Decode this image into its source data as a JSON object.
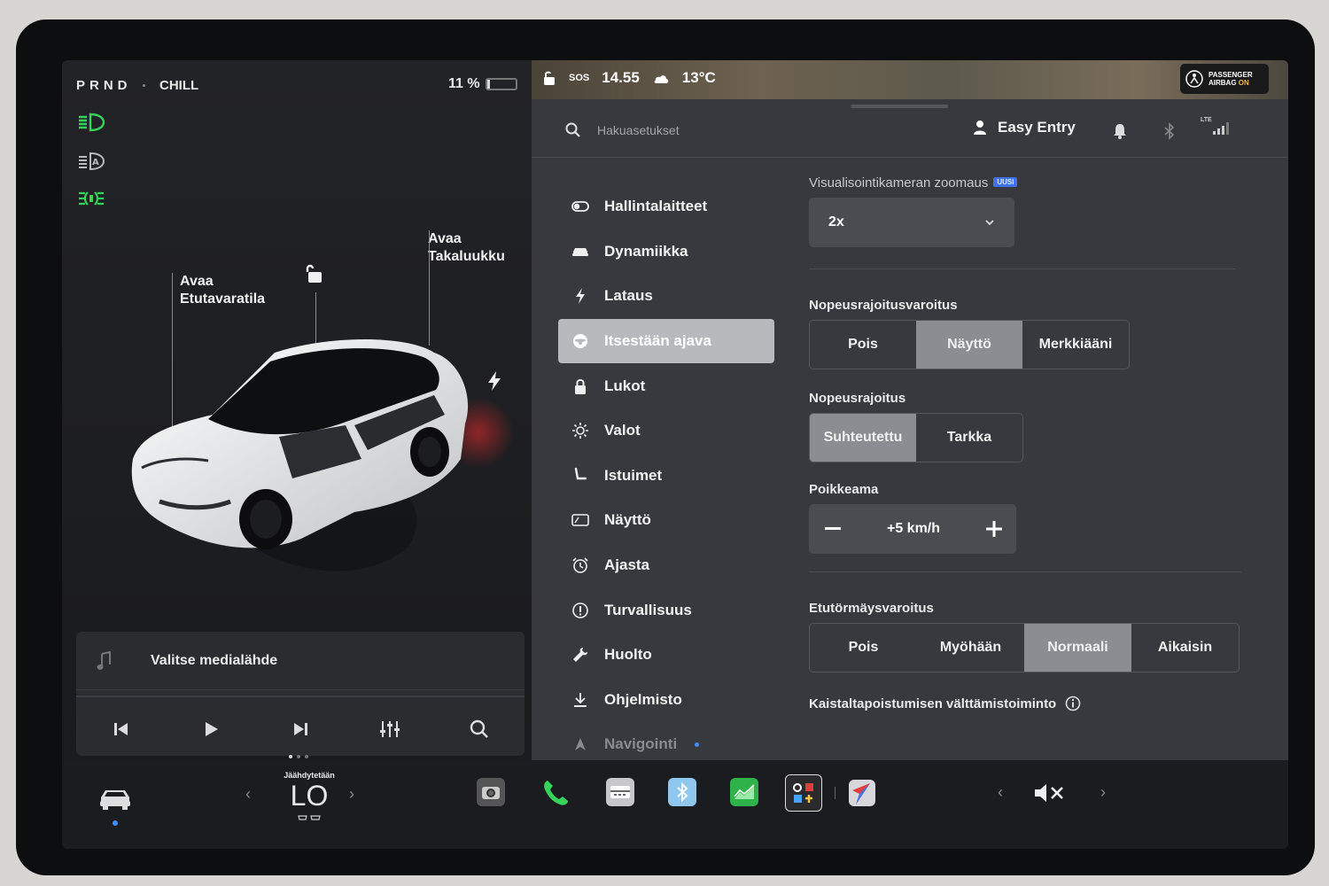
{
  "car": {
    "gear": "PRND",
    "drive_mode": "CHILL",
    "battery_text": "11 %",
    "battery_percent": 11,
    "frunk_line1": "Avaa",
    "frunk_line2": "Etutavaratila",
    "trunk_line1": "Avaa",
    "trunk_line2": "Takaluukku"
  },
  "media": {
    "source_label": "Valitse medialähde"
  },
  "topbar": {
    "sos": "SOS",
    "time": "14.55",
    "temperature": "13°C",
    "airbag_line1": "PASSENGER",
    "airbag_line2": "AIRBAG",
    "airbag_state": "ON",
    "network": "LTE"
  },
  "header": {
    "search_placeholder": "Hakuasetukset",
    "profile_name": "Easy Entry"
  },
  "nav": [
    {
      "label": "Hallintalaitteet",
      "icon": "toggle-icon"
    },
    {
      "label": "Dynamiikka",
      "icon": "car-icon"
    },
    {
      "label": "Lataus",
      "icon": "bolt-icon"
    },
    {
      "label": "Itsestään ajava",
      "icon": "steering-wheel-icon",
      "active": true
    },
    {
      "label": "Lukot",
      "icon": "lock-icon"
    },
    {
      "label": "Valot",
      "icon": "sun-icon"
    },
    {
      "label": "Istuimet",
      "icon": "seat-icon"
    },
    {
      "label": "Näyttö",
      "icon": "display-icon"
    },
    {
      "label": "Ajasta",
      "icon": "alarm-clock-icon"
    },
    {
      "label": "Turvallisuus",
      "icon": "info-circle-icon"
    },
    {
      "label": "Huolto",
      "icon": "wrench-icon"
    },
    {
      "label": "Ohjelmisto",
      "icon": "download-icon"
    },
    {
      "label": "Navigointi",
      "icon": "navigation-icon"
    }
  ],
  "content": {
    "zoom_label": "Visualisointikameran zoomaus",
    "zoom_badge": "UUSI",
    "zoom_value": "2x",
    "speed_warning_label": "Nopeusrajoitusvaroitus",
    "speed_warning_options": [
      "Pois",
      "Näyttö",
      "Merkkiääni"
    ],
    "speed_warning_selected": 1,
    "speed_limit_label": "Nopeusrajoitus",
    "speed_limit_options": [
      "Suhteutettu",
      "Tarkka"
    ],
    "speed_limit_selected": 0,
    "offset_label": "Poikkeama",
    "offset_value": "+5 km/h",
    "fcw_label": "Etutörmäysvaroitus",
    "fcw_options": [
      "Pois",
      "Myöhään",
      "Normaali",
      "Aikaisin"
    ],
    "fcw_selected": 2,
    "lane_label": "Kaistaltapoistumisen välttämistoiminto"
  },
  "dock": {
    "climate_status": "Jäähdytetään",
    "climate_value": "LO"
  },
  "colors": {
    "accent_green": "#36d35a",
    "selected_segment": "#8c8d92",
    "badge_blue": "#3e74e8"
  }
}
